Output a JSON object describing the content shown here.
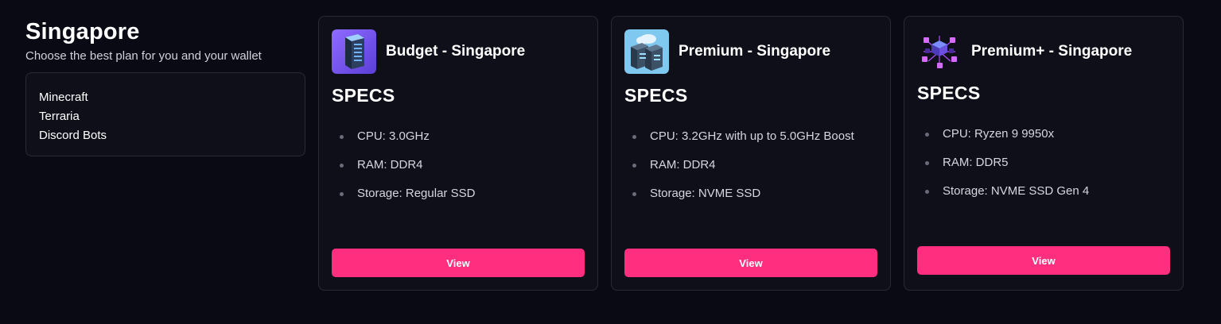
{
  "intro": {
    "title": "Singapore",
    "subtitle": "Choose the best plan for you and your wallet",
    "games": [
      "Minecraft",
      "Terraria",
      "Discord Bots"
    ]
  },
  "plans": [
    {
      "title": "Budget - Singapore",
      "icon": "server-rack-icon",
      "specs_title": "SPECS",
      "specs": [
        "CPU: 3.0GHz",
        "RAM: DDR4",
        "Storage: Regular SSD"
      ],
      "button_label": "View"
    },
    {
      "title": "Premium - Singapore",
      "icon": "cloud-server-icon",
      "specs_title": "SPECS",
      "specs": [
        "CPU: 3.2GHz with up to 5.0GHz Boost",
        "RAM: DDR4",
        "Storage: NVME SSD"
      ],
      "button_label": "View"
    },
    {
      "title": "Premium+ - Singapore",
      "icon": "isometric-network-icon",
      "specs_title": "SPECS",
      "specs": [
        "CPU: Ryzen 9 9950x",
        "RAM: DDR5",
        "Storage: NVME SSD Gen 4"
      ],
      "button_label": "View"
    }
  ],
  "colors": {
    "background": "#0a0a14",
    "card": "#0f0f1a",
    "border": "#2a2a37",
    "accent": "#ff2e7e"
  }
}
